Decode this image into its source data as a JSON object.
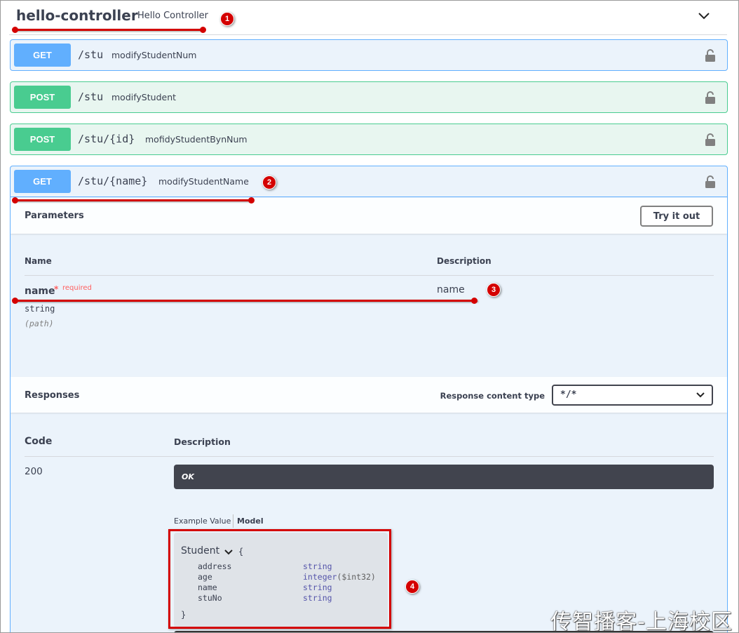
{
  "tag": {
    "name": "hello-controller",
    "description": "Hello Controller"
  },
  "operations": [
    {
      "method": "GET",
      "path": "/stu",
      "summary": "modifyStudentNum"
    },
    {
      "method": "POST",
      "path": "/stu",
      "summary": "modifyStudent"
    },
    {
      "method": "POST",
      "path": "/stu/{id}",
      "summary": "mofidyStudentBynNum"
    },
    {
      "method": "GET",
      "path": "/stu/{name}",
      "summary": "modifyStudentName"
    }
  ],
  "parameters": {
    "title": "Parameters",
    "try_label": "Try it out",
    "col_name": "Name",
    "col_desc": "Description",
    "items": [
      {
        "name": "name",
        "required_star": "*",
        "required_text": "required",
        "type": "string",
        "in": "(path)",
        "description": "name"
      }
    ]
  },
  "responses": {
    "title": "Responses",
    "content_type_label": "Response content type",
    "content_type_value": "*/*",
    "col_code": "Code",
    "col_desc": "Description",
    "items": [
      {
        "code": "200",
        "description": "OK"
      }
    ],
    "tab_example": "Example Value",
    "tab_model": "Model"
  },
  "model": {
    "name": "Student",
    "open": "{",
    "close": "}",
    "fields": [
      {
        "name": "address",
        "type": "string",
        "format": ""
      },
      {
        "name": "age",
        "type": "integer",
        "format": "($int32)"
      },
      {
        "name": "name",
        "type": "string",
        "format": ""
      },
      {
        "name": "stuNo",
        "type": "string",
        "format": ""
      }
    ]
  },
  "annotations": [
    "1",
    "2",
    "3",
    "4"
  ],
  "watermark": "传智播客-上海校区",
  "colors": {
    "get": "#61affe",
    "post": "#49cc90",
    "annotation": "#d40000",
    "dark_bar": "#41444e"
  }
}
